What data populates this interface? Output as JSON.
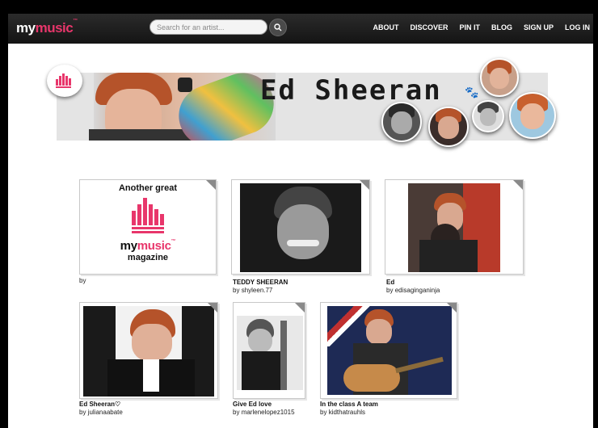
{
  "header": {
    "logo_main": "my",
    "logo_accent": "music",
    "logo_tm": "™",
    "search_placeholder": "Search for an artist...",
    "nav": [
      "ABOUT",
      "DISCOVER",
      "PIN IT",
      "BLOG",
      "SIGN UP",
      "LOG IN"
    ]
  },
  "banner": {
    "title": "Ed Sheeran"
  },
  "cards": [
    {
      "title": "",
      "by_label": "by",
      "author": "",
      "magazine": {
        "top": "Another great",
        "logo_main": "my",
        "logo_accent": "music",
        "logo_tm": "™",
        "bottom": "magazine"
      }
    },
    {
      "title": "TEDDY SHEERAN",
      "by_label": "by",
      "author": "shyleen.77"
    },
    {
      "title": "Ed",
      "by_label": "by",
      "author": "edisaginganinja"
    },
    {
      "title": "Ed Sheeran♡",
      "by_label": "by",
      "author": "julianaabate"
    },
    {
      "title": "Give Ed love",
      "by_label": "by",
      "author": "marlenelopez1015"
    },
    {
      "title": "In the class A team",
      "by_label": "by",
      "author": "kidthatrauhls"
    }
  ],
  "colors": {
    "accent": "#e8366b",
    "topbar": "#1c1c1c",
    "background": "#ffffff"
  }
}
